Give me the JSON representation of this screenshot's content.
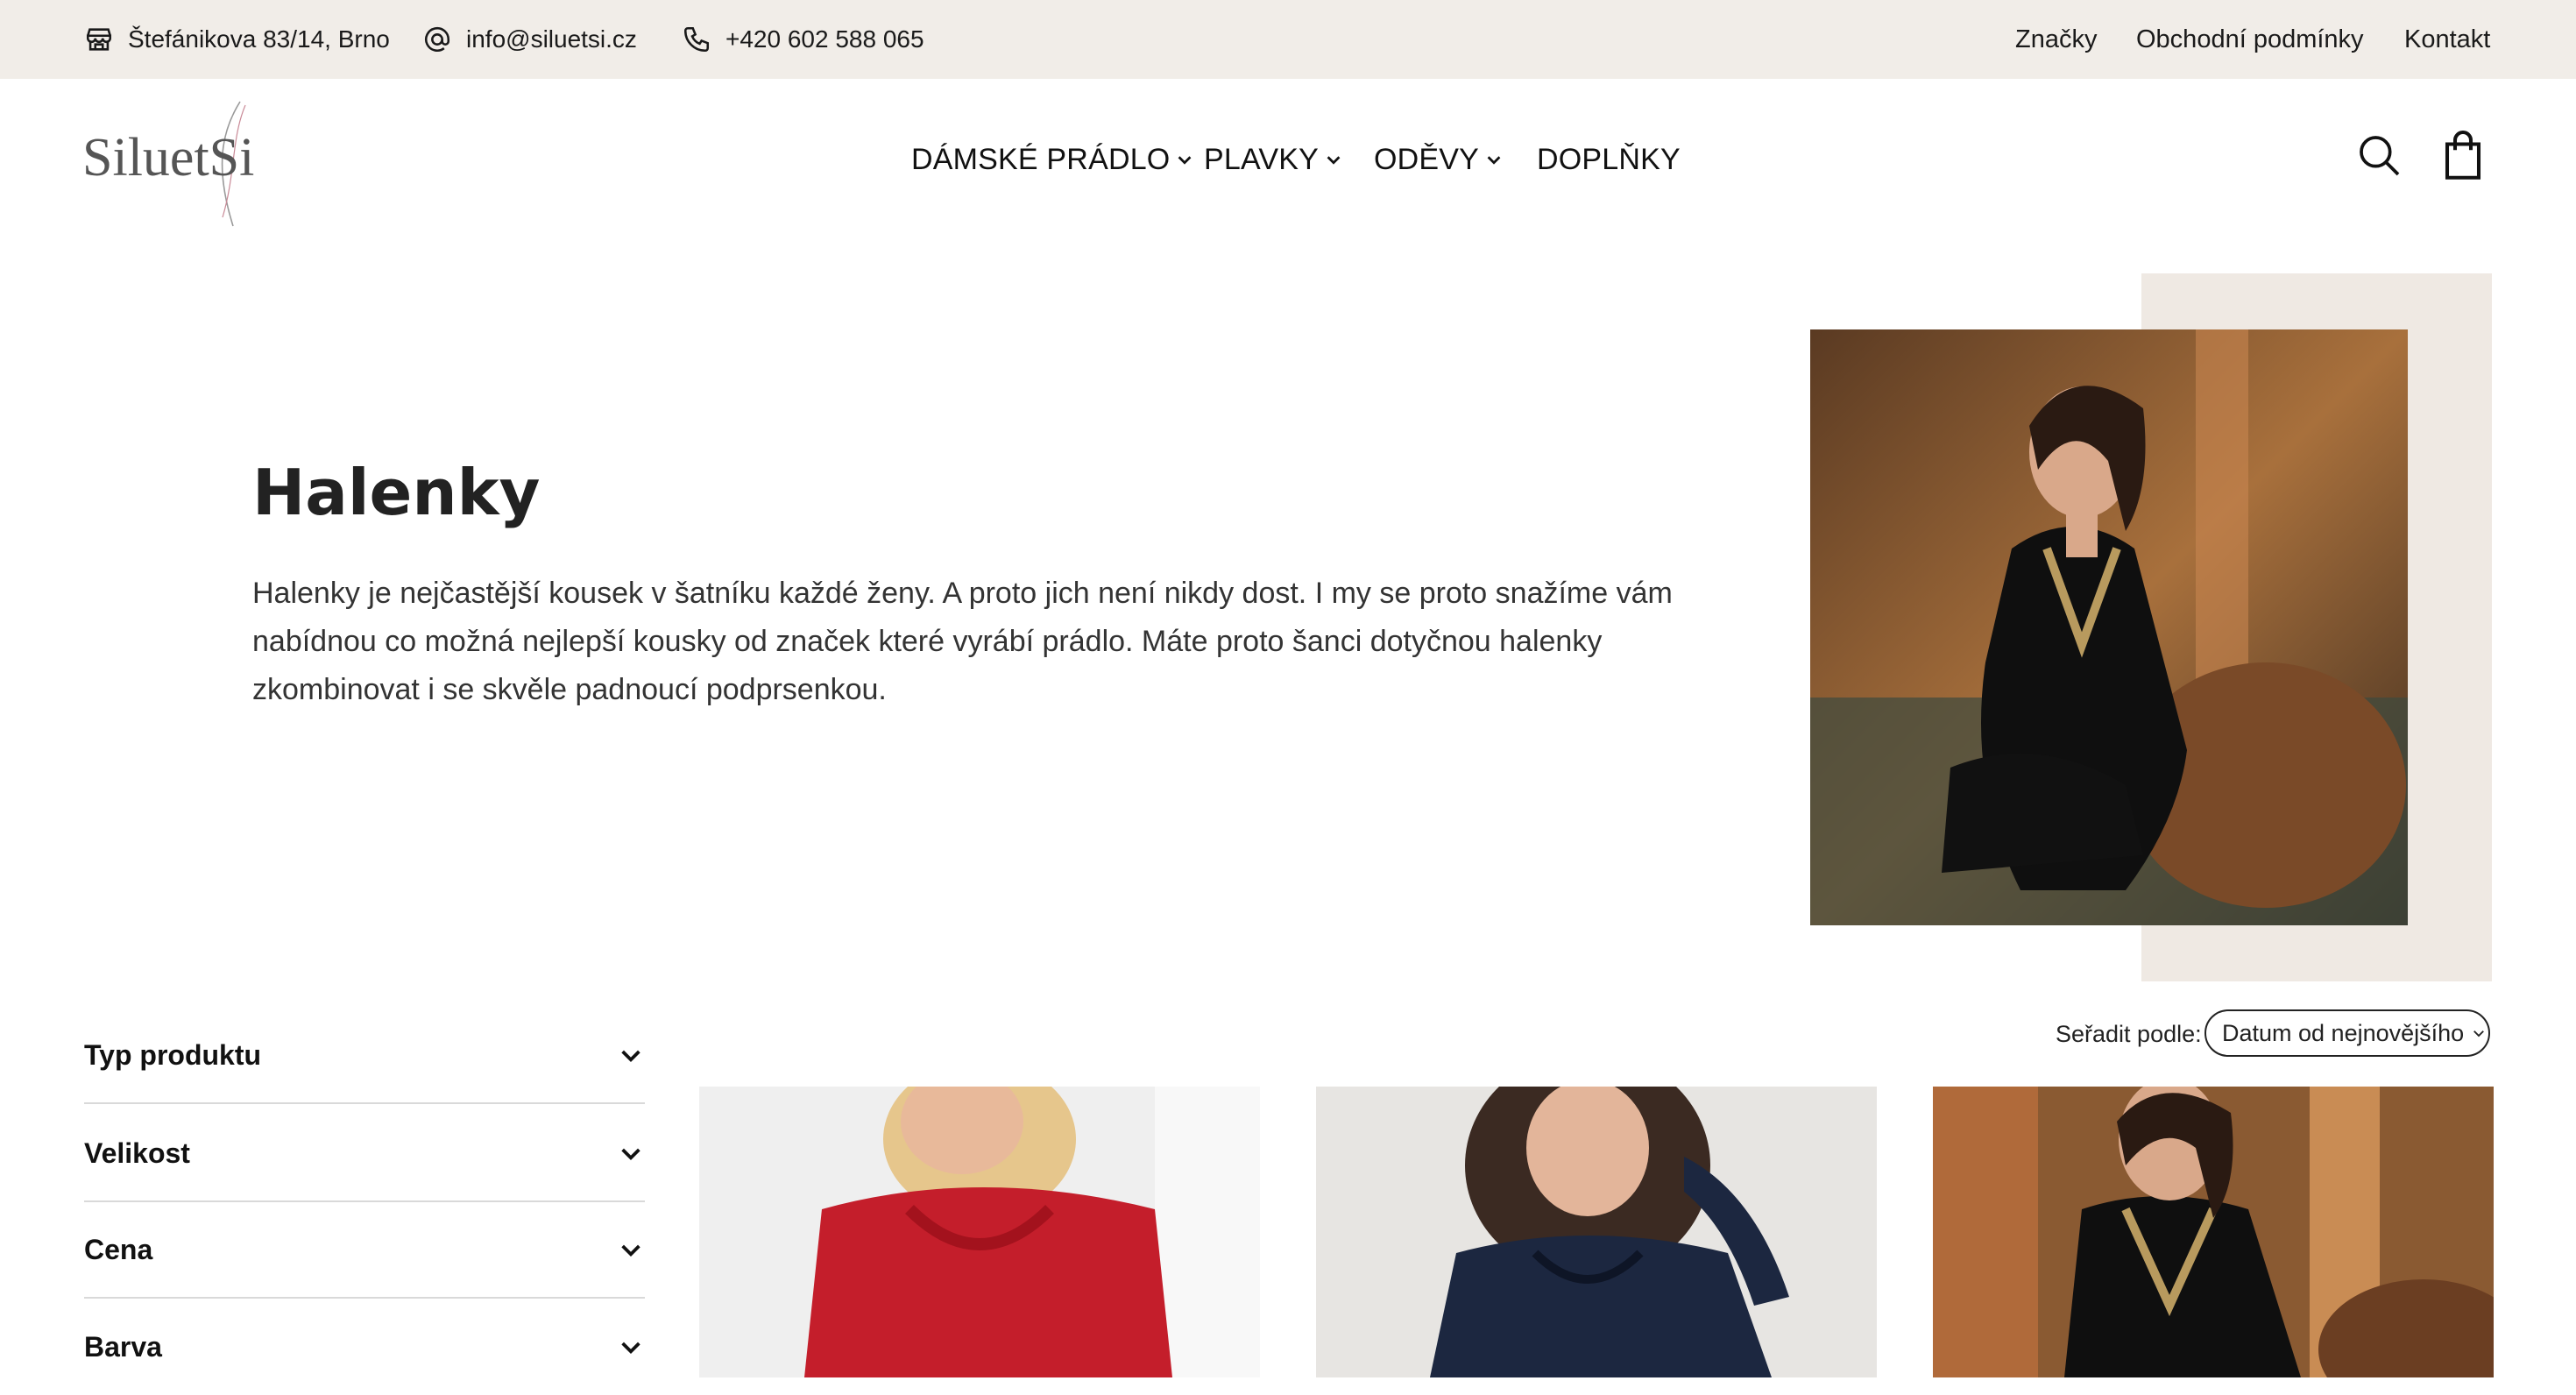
{
  "topbar": {
    "address": "Štefánikova 83/14, Brno",
    "email": "info@siluetsi.cz",
    "phone": "+420 602 588 065",
    "links": [
      "Značky",
      "Obchodní podmínky",
      "Kontakt"
    ]
  },
  "logo": {
    "text": "SiluetSi"
  },
  "nav": {
    "items": [
      "DÁMSKÉ PRÁDLO",
      "PLAVKY",
      "ODĚVY",
      "DOPLŇKY"
    ]
  },
  "hero": {
    "title": "Halenky",
    "description": "Halenky je nejčastější kousek v šatníku každé ženy. A proto jich není nikdy dost. I my se proto snažíme vám nabídnou co možná nejlepší kousky od značek které vyrábí prádlo. Máte proto šanci dotyčnou halenky zkombinovat i se skvěle padnoucí podprsenkou."
  },
  "sort": {
    "label": "Seřadit podle:",
    "selected": "Datum od nejnovějšího"
  },
  "filters": [
    "Typ produktu",
    "Velikost",
    "Cena",
    "Barva"
  ],
  "colors": {
    "topbar_bg": "#f1ede8",
    "hero_accent_bg": "#efe9e3",
    "logo_pink": "#d88a9a"
  }
}
